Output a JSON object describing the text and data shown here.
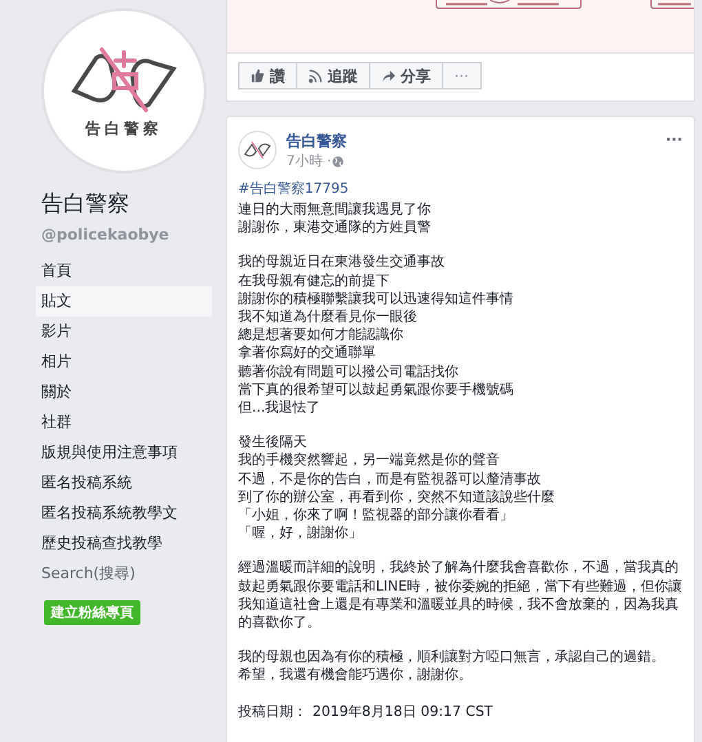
{
  "page": {
    "avatar_text": "告白警察",
    "name": "告白警察",
    "handle": "@policekaobye"
  },
  "sidebar": {
    "items": [
      {
        "label": "首頁",
        "selected": false,
        "kind": "link"
      },
      {
        "label": "貼文",
        "selected": true,
        "kind": "link"
      },
      {
        "label": "影片",
        "selected": false,
        "kind": "link"
      },
      {
        "label": "相片",
        "selected": false,
        "kind": "link"
      },
      {
        "label": "關於",
        "selected": false,
        "kind": "link"
      },
      {
        "label": "社群",
        "selected": false,
        "kind": "link"
      },
      {
        "label": "版規與使用注意事項",
        "selected": false,
        "kind": "link"
      },
      {
        "label": "匿名投稿系統",
        "selected": false,
        "kind": "link"
      },
      {
        "label": "匿名投稿系統教學文",
        "selected": false,
        "kind": "link"
      },
      {
        "label": "歷史投稿查找教學",
        "selected": false,
        "kind": "link"
      },
      {
        "label": "Search(搜尋)",
        "selected": false,
        "kind": "muted"
      }
    ],
    "create_button": "建立粉絲專頁"
  },
  "actions": [
    {
      "label": "讚",
      "kind": "like"
    },
    {
      "label": "追蹤",
      "kind": "follow"
    },
    {
      "label": "分享",
      "kind": "share"
    },
    {
      "label": "···",
      "kind": "more"
    }
  ],
  "post": {
    "author": "告白警察",
    "time": "7小時 · ",
    "more": "···",
    "hashtag": "#告白警察17795",
    "paragraphs": [
      [
        "連日的大雨無意間讓我遇見了你",
        "謝謝你，東港交通隊的方姓員警"
      ],
      [
        "我的母親近日在東港發生交通事故",
        "在我母親有健忘的前提下",
        "謝謝你的積極聯繫讓我可以迅速得知這件事情",
        "我不知道為什麼看見你一眼後",
        "總是想著要如何才能認識你",
        "拿著你寫好的交通聯單",
        "聽著你說有問題可以撥公司電話找你",
        "當下真的很希望可以鼓起勇氣跟你要手機號碼",
        "但...我退怯了"
      ],
      [
        "發生後隔天",
        "我的手機突然響起，另一端竟然是你的聲音",
        "不過，不是你的告白，而是有監視器可以釐清事故",
        "到了你的辦公室，再看到你，突然不知道該說些什麼",
        "「小姐，你來了啊！監視器的部分讓你看看」",
        "「喔，好，謝謝你」"
      ],
      [
        "經過溫暖而詳細的說明，我終於了解為什麼我會喜歡你，不過，當我真的鼓起勇氣跟你要電話和LINE時，被你委婉的拒絕，當下有些難過，但你讓我知道這社會上還是有專業和溫暖並具的時候，我不會放棄的，因為我真的喜歡你了。"
      ],
      [
        "我的母親也因為有你的積極，順利讓對方啞口無言，承認自己的過錯。",
        "希望，我還有機會能巧遇你，謝謝你。"
      ]
    ],
    "posted_label": "投稿日期：",
    "posted_date": "2019年8月18日 09:17 CST"
  }
}
